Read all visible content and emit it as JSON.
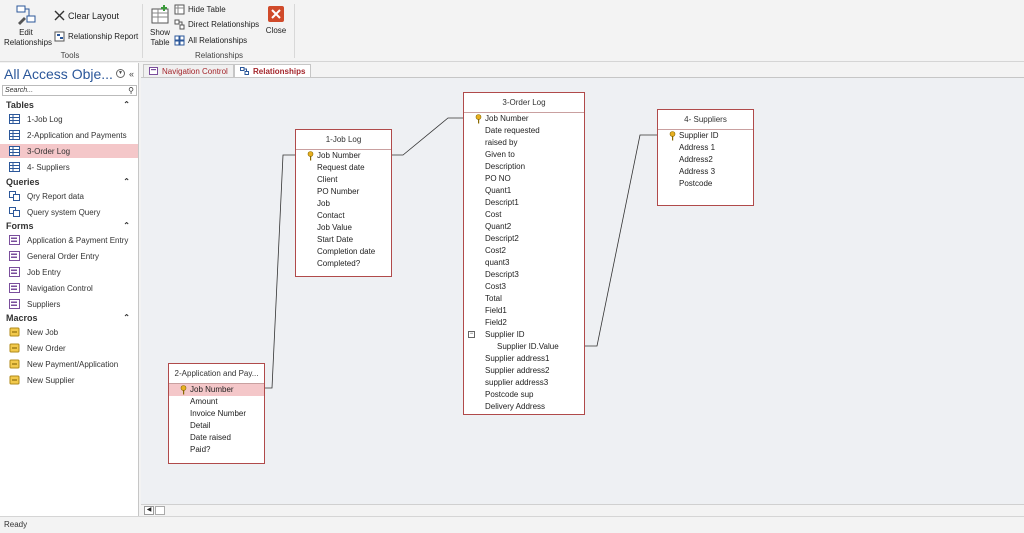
{
  "ribbon": {
    "tools": {
      "label": "Tools",
      "edit_relationships": "Edit Relationships",
      "clear_layout": "Clear Layout",
      "relationship_report": "Relationship Report"
    },
    "relationships": {
      "label": "Relationships",
      "show_table": "Show Table",
      "hide_table": "Hide Table",
      "direct_relationships": "Direct Relationships",
      "all_relationships": "All Relationships",
      "close": "Close"
    }
  },
  "nav": {
    "title": "All Access Obje...",
    "search_placeholder": "Search...",
    "sections": [
      {
        "label": "Tables",
        "items": [
          {
            "label": "1-Job Log",
            "icon": "table-icon"
          },
          {
            "label": "2-Application and Payments",
            "icon": "table-icon"
          },
          {
            "label": "3-Order Log",
            "icon": "table-icon",
            "selected": true
          },
          {
            "label": "4- Suppliers",
            "icon": "table-icon"
          }
        ]
      },
      {
        "label": "Queries",
        "items": [
          {
            "label": "Qry Report data",
            "icon": "query-icon"
          },
          {
            "label": "Query system Query",
            "icon": "query-icon"
          }
        ]
      },
      {
        "label": "Forms",
        "items": [
          {
            "label": "Application & Payment Entry",
            "icon": "form-icon"
          },
          {
            "label": "General Order Entry",
            "icon": "form-icon"
          },
          {
            "label": "Job Entry",
            "icon": "form-icon"
          },
          {
            "label": "Navigation Control",
            "icon": "form-icon"
          },
          {
            "label": "Suppliers",
            "icon": "form-icon"
          }
        ]
      },
      {
        "label": "Macros",
        "items": [
          {
            "label": "New Job",
            "icon": "macro-icon"
          },
          {
            "label": "New Order",
            "icon": "macro-icon"
          },
          {
            "label": "New Payment/Application",
            "icon": "macro-icon"
          },
          {
            "label": "New Supplier",
            "icon": "macro-icon"
          }
        ]
      }
    ]
  },
  "tabs": [
    {
      "label": "Navigation Control",
      "active": false
    },
    {
      "label": "Relationships",
      "active": true
    }
  ],
  "diagram": {
    "tables": [
      {
        "id": "joblog",
        "title": "1-Job Log",
        "fields": [
          "Job Number",
          "Request date",
          "Client",
          "PO Number",
          "Job",
          "Contact",
          "Job Value",
          "Start Date",
          "Completion date",
          "Completed?"
        ],
        "key": "Job Number"
      },
      {
        "id": "apppay",
        "title": "2-Application and Pay...",
        "fields": [
          "Job Number",
          "Amount",
          "Invoice Number",
          "Detail",
          "Date raised",
          "Paid?"
        ],
        "key": "Job Number"
      },
      {
        "id": "orderlog",
        "title": "3-Order Log",
        "fields": [
          "Job Number",
          "Date requested",
          "raised by",
          "Given to",
          "Description",
          "PO NO",
          "Quant1",
          "Descript1",
          "Cost",
          "Quant2",
          "Descript2",
          "Cost2",
          "quant3",
          "Descript3",
          "Cost3",
          "Total",
          "Field1",
          "Field2",
          "Supplier ID",
          "Supplier ID.Value",
          "Supplier address1",
          "Supplier address2",
          "supplier address3",
          "Postcode sup",
          "Delivery Address"
        ],
        "key": "Job Number"
      },
      {
        "id": "suppliers",
        "title": "4- Suppliers",
        "fields": [
          "Supplier ID",
          "Address 1",
          "Address2",
          "Address 3",
          "Postcode"
        ],
        "key": "Supplier ID"
      }
    ]
  },
  "status": {
    "text": "Ready"
  },
  "colors": {
    "accent": "#a4262c",
    "brand": "#2b579a",
    "selection": "#f4c7c9"
  }
}
